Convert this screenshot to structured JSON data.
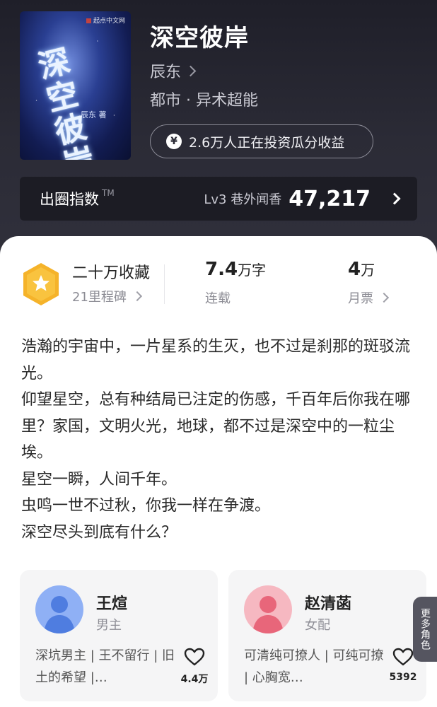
{
  "book": {
    "title": "深空彼岸",
    "author": "辰东",
    "genre": "都市 · 异术超能",
    "invest_text": "2.6万人正在投资瓜分收益",
    "cover": {
      "art_text": "深空彼岸",
      "author_tag": "辰东 著",
      "brand": "起点中文网"
    }
  },
  "index_bar": {
    "label": "出圈指数",
    "tm": "TM",
    "level": "Lv3 巷外闻香",
    "value": "47,217"
  },
  "stats": {
    "collect_main": "二十万收藏",
    "collect_sub": "21里程碑",
    "words_num": "7.4",
    "words_unit": "万字",
    "words_sub": "连载",
    "votes_num": "4",
    "votes_unit": "万",
    "votes_sub": "月票"
  },
  "description": [
    "浩瀚的宇宙中，一片星系的生灭，也不过是刹那的斑驳流光。",
    "仰望星空，总有种结局已注定的伤感，千百年后你我在哪里？家国，文明火光，地球，都不过是深空中的一粒尘埃。",
    "星空一瞬，人间千年。",
    "虫鸣一世不过秋，你我一样在争渡。",
    "深空尽头到底有什么？"
  ],
  "roles": [
    {
      "name": "王煊",
      "type": "男主",
      "tags": "深坑男主 | 王不留行 | 旧土的希望 |…",
      "likes": "4.4万",
      "color": "#5a86e8"
    },
    {
      "name": "赵清菡",
      "type": "女配",
      "tags": "可清纯可撩人 | 可纯可撩 | 心胸宽…",
      "likes": "5392",
      "color": "#ee7d8d"
    }
  ],
  "more_roles": "更多角色",
  "colors": {
    "badge": "#f5b32a",
    "header_bg": "#2b2b36"
  }
}
